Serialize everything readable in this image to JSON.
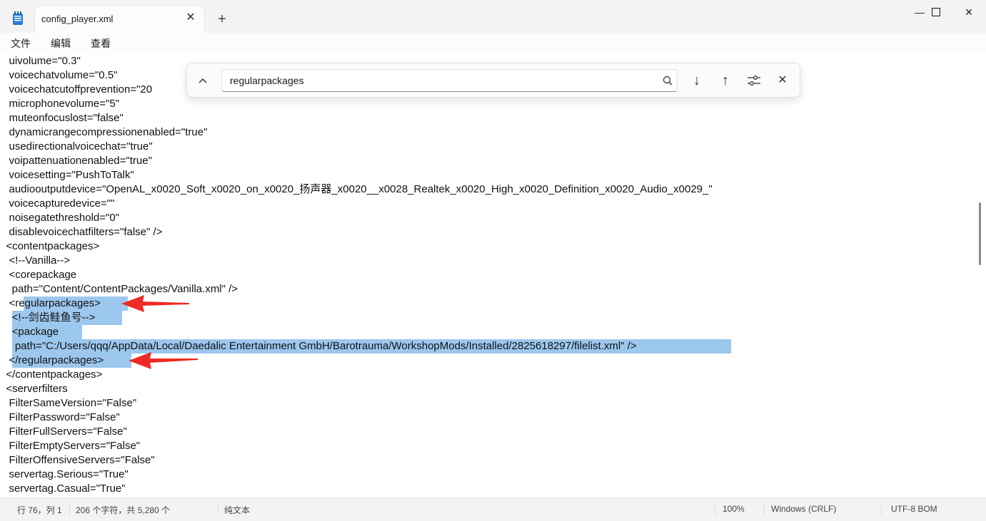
{
  "window": {
    "tab_title": "config_player.xml",
    "tab_close": "✕",
    "new_tab": "+",
    "minimize": "—",
    "maximize": "☐",
    "close": "✕"
  },
  "menu": {
    "file": "文件",
    "edit": "编辑",
    "view": "查看"
  },
  "find": {
    "query": "regularpackages",
    "collapse": "⌃",
    "next": "↓",
    "prev": "↑",
    "close": "✕"
  },
  "editor": {
    "lines": [
      "   uivolume=\"0.3\"",
      "   voicechatvolume=\"0.5\"",
      "   voicechatcutoffprevention=\"20",
      "   microphonevolume=\"5\"",
      "   muteonfocuslost=\"false\"",
      "   dynamicrangecompressionenabled=\"true\"",
      "   usedirectionalvoicechat=\"true\"",
      "   voipattenuationenabled=\"true\"",
      "   voicesetting=\"PushToTalk\"",
      "   audiooutputdevice=\"OpenAL_x0020_Soft_x0020_on_x0020_扬声器_x0020__x0028_Realtek_x0020_High_x0020_Definition_x0020_Audio_x0029_\"",
      "   voicecapturedevice=\"\"",
      "   noisegatethreshold=\"0\"",
      "   disablevoicechatfilters=\"false\" />",
      "  <contentpackages>",
      "   <!--Vanilla-->",
      "   <corepackage",
      "    path=\"Content/ContentPackages/Vanilla.xml\" />",
      "   <regularpackages>",
      "    <!--剑齿鲑鱼号-->",
      "    <package",
      "     path=\"C:/Users/qqq/AppData/Local/Daedalic Entertainment GmbH/Barotrauma/WorkshopMods/Installed/2825618297/filelist.xml\" />",
      "   </regularpackages>",
      "  </contentpackages>",
      "  <serverfilters",
      "   FilterSameVersion=\"False\"",
      "   FilterPassword=\"False\"",
      "   FilterFullServers=\"False\"",
      "   FilterEmptyServers=\"False\"",
      "   FilterOffensiveServers=\"False\"",
      "   servertag.Serious=\"True\"",
      "   servertag.Casual=\"True\""
    ]
  },
  "status": {
    "position": "行 76，列 1",
    "chars": "206 个字符，共 5,280 个",
    "format": "纯文本",
    "zoom": "100%",
    "line_ending": "Windows (CRLF)",
    "encoding": "UTF-8 BOM"
  }
}
